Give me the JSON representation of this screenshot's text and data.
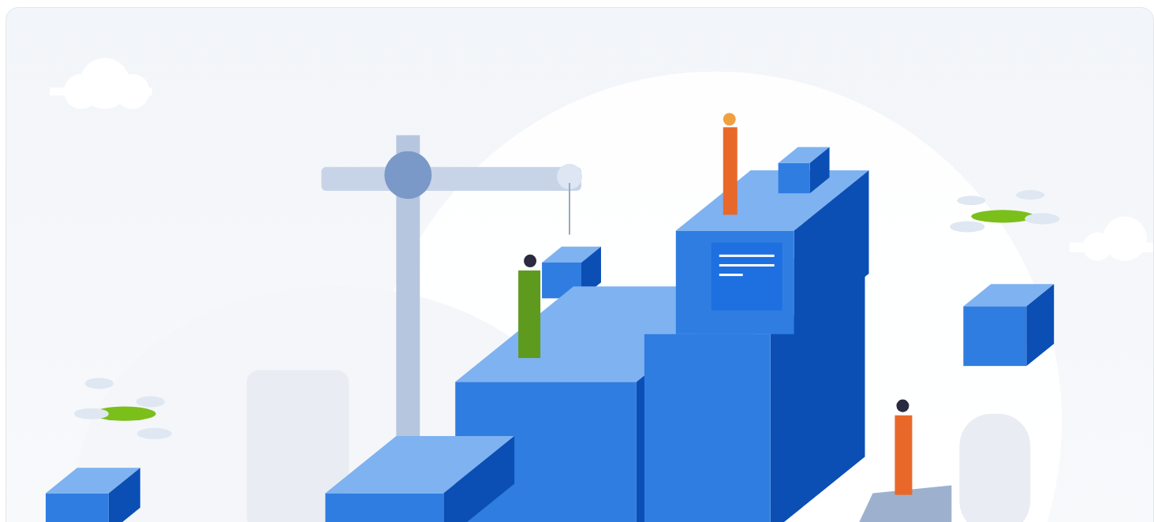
{
  "card": {
    "kind": "illustration"
  }
}
